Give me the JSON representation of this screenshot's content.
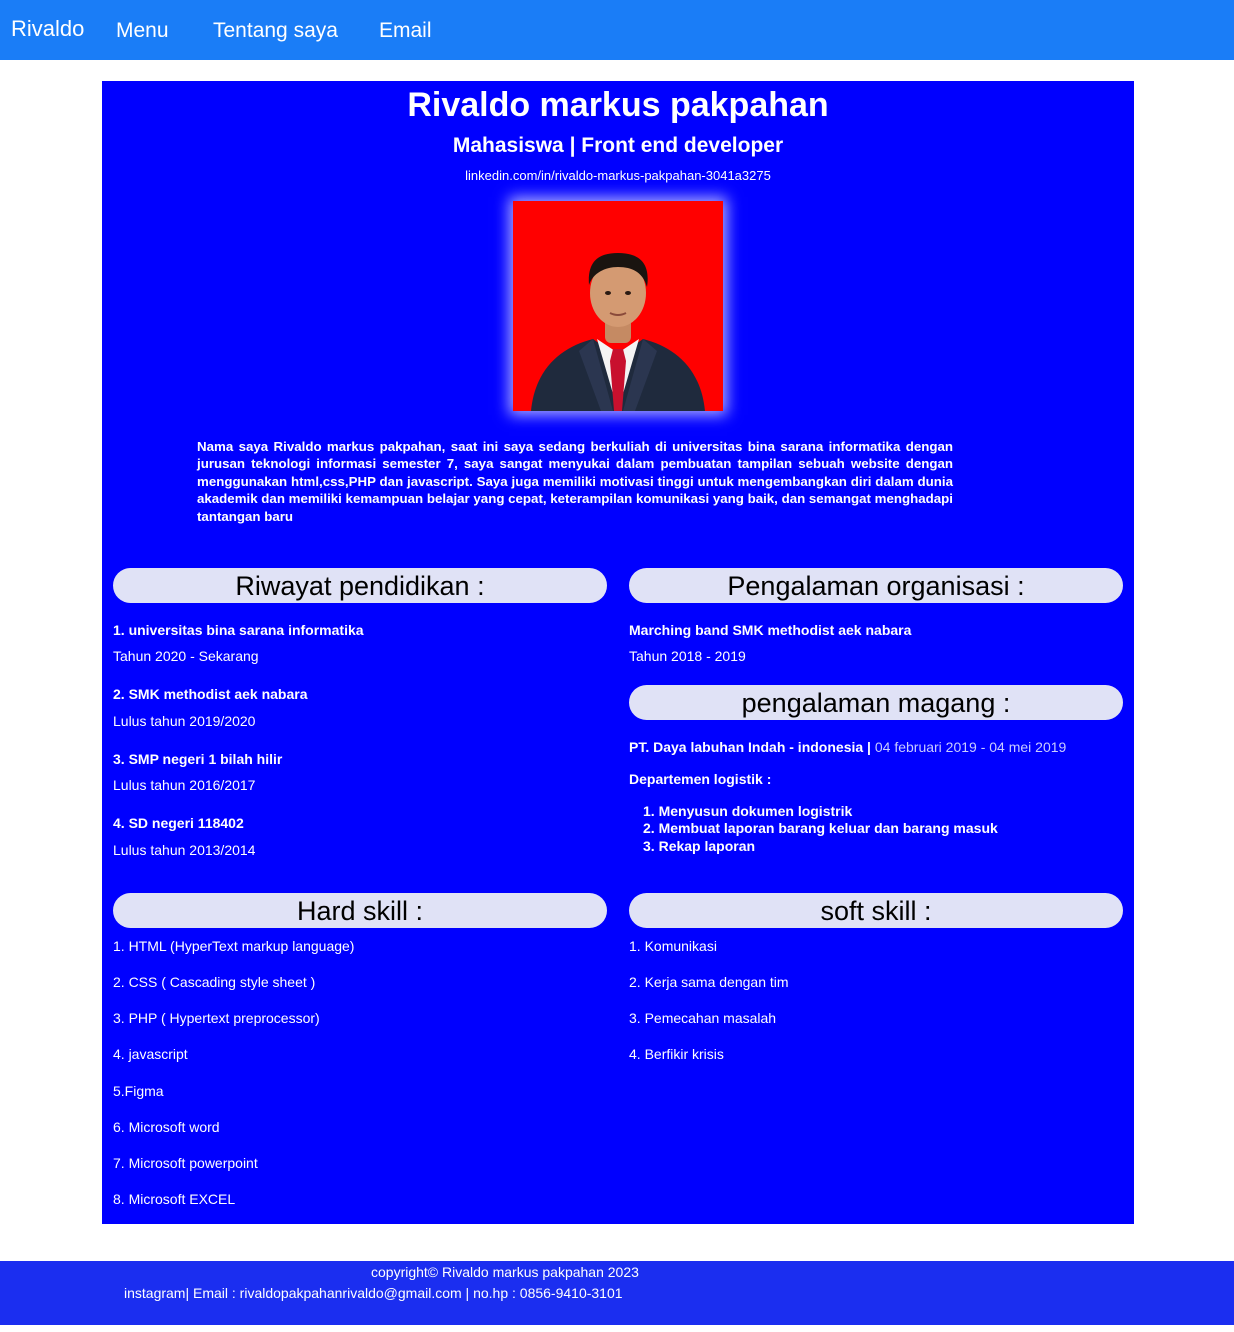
{
  "nav": {
    "brand": "Rivaldo",
    "links": [
      "Menu",
      "Tentang saya",
      "Email"
    ]
  },
  "profile": {
    "name": "Rivaldo markus pakpahan",
    "subtitle": "Mahasiswa | Front end developer",
    "linkedin": "linkedin.com/in/rivaldo-markus-pakpahan-3041a3275",
    "photo_bg": "#ff0000",
    "about": "Nama saya Rivaldo markus pakpahan, saat ini saya sedang berkuliah di universitas bina sarana informatika dengan jurusan teknologi informasi semester 7, saya sangat menyukai dalam pembuatan tampilan sebuah website dengan menggunakan html,css,PHP dan javascript. Saya juga memiliki motivasi tinggi untuk mengembangkan diri dalam dunia akademik dan memiliki kemampuan belajar yang cepat, keterampilan komunikasi yang baik, dan semangat menghadapi tantangan baru"
  },
  "education": {
    "heading": "Riwayat pendidikan :",
    "items": [
      {
        "title": "1. universitas bina sarana informatika",
        "detail": "Tahun 2020 - Sekarang"
      },
      {
        "title": "2. SMK methodist aek nabara",
        "detail": "Lulus tahun 2019/2020"
      },
      {
        "title": "3. SMP negeri 1 bilah hilir",
        "detail": "Lulus tahun 2016/2017"
      },
      {
        "title": "4. SD negeri 118402",
        "detail": "Lulus tahun 2013/2014"
      }
    ]
  },
  "organization": {
    "heading": "Pengalaman organisasi :",
    "title": "Marching band SMK methodist aek nabara",
    "detail": "Tahun 2018 - 2019"
  },
  "internship": {
    "heading": "pengalaman magang :",
    "company": "PT. Daya labuhan Indah - indonesia",
    "separator": "|",
    "period": "04 februari 2019 - 04 mei 2019",
    "department": "Departemen logistik :",
    "tasks": [
      "Menyusun dokumen logistrik",
      "Membuat laporan barang keluar dan barang masuk",
      "Rekap laporan"
    ]
  },
  "hard_skill": {
    "heading": "Hard skill :",
    "items": [
      "1. HTML (HyperText markup language)",
      "2. CSS ( Cascading style sheet )",
      "3. PHP ( Hypertext preprocessor)",
      "4. javascript",
      "5.Figma",
      "6. Microsoft word",
      "7. Microsoft powerpoint",
      "8. Microsoft EXCEL"
    ]
  },
  "soft_skill": {
    "heading": "soft skill :",
    "items": [
      "1. Komunikasi",
      "2. Kerja sama dengan tim",
      "3. Pemecahan masalah",
      "4. Berfikir krisis"
    ]
  },
  "footer": {
    "copyright": "copyright© Rivaldo markus pakpahan 2023",
    "contact": "instagram| Email : rivaldopakpahanrivaldo@gmail.com | no.hp : 0856-9410-3101"
  },
  "colors": {
    "navbar": "#1a7df7",
    "content": "#0000ff",
    "pill": "#e0e2f6",
    "footer": "#1b2ef0"
  }
}
